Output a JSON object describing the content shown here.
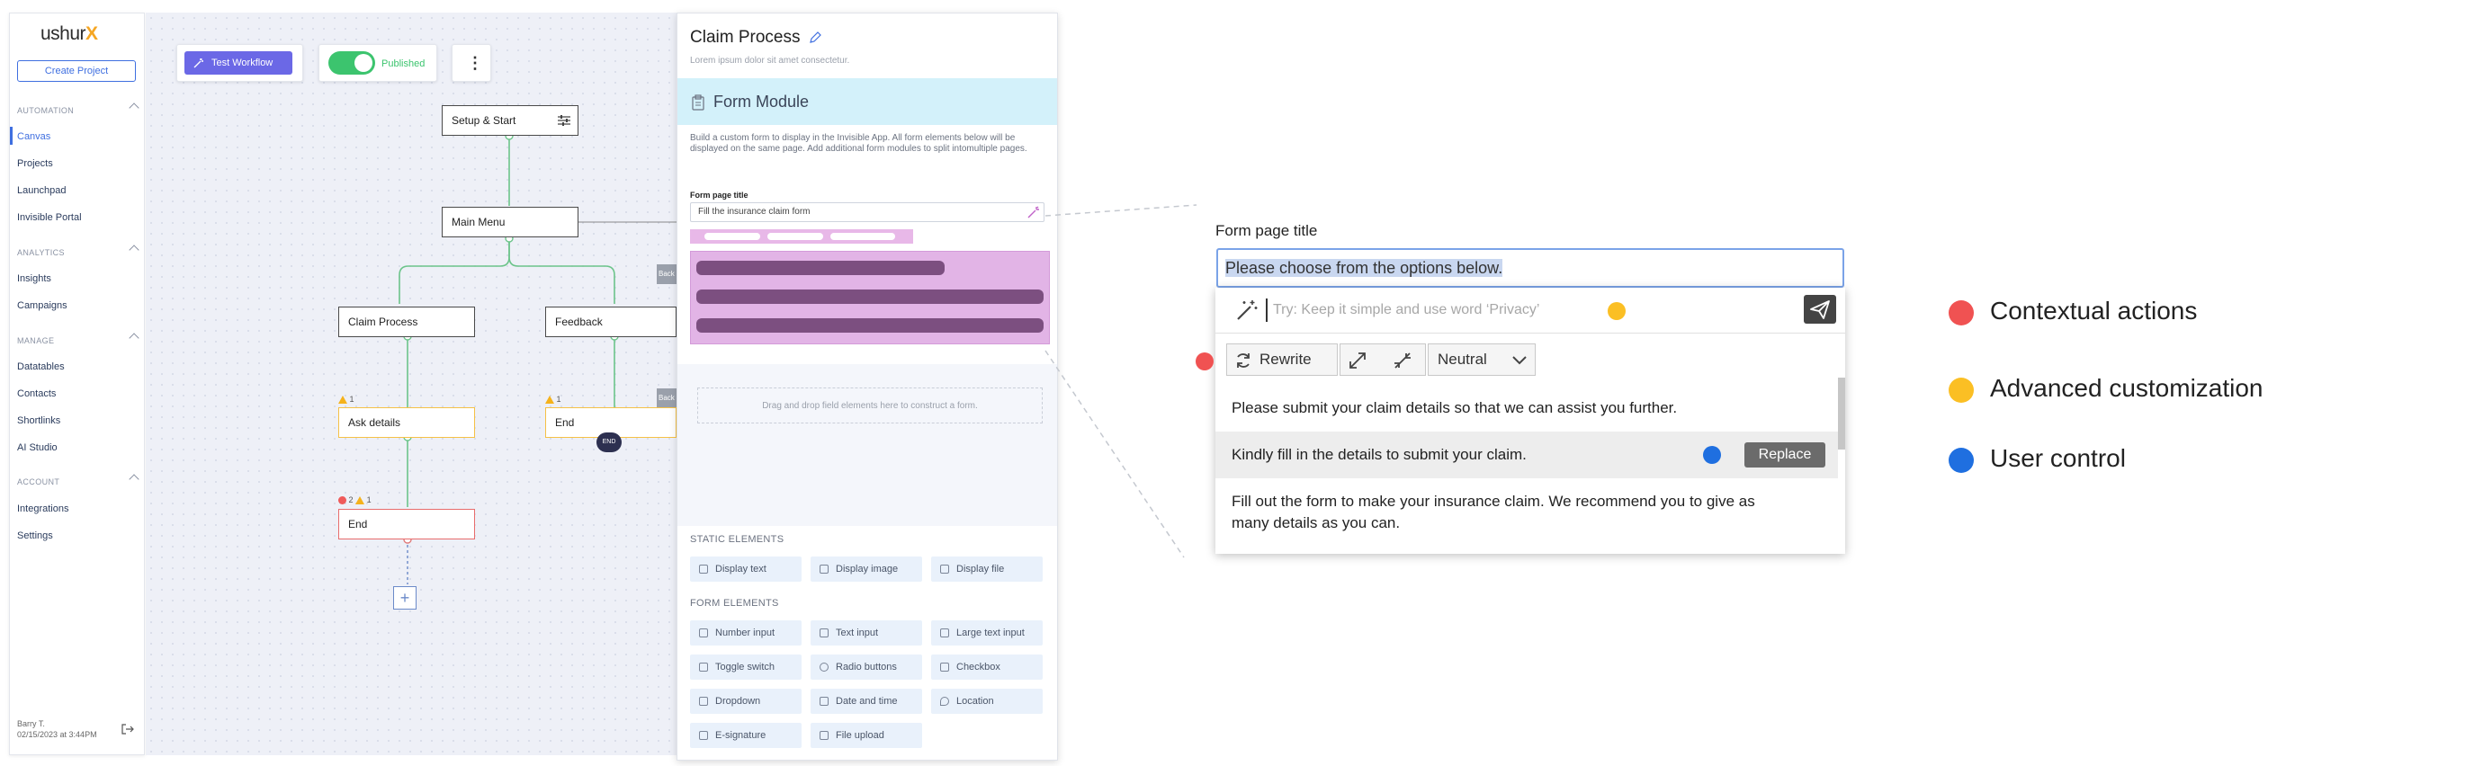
{
  "sidebar": {
    "logo_text": "ushur",
    "logo_mark": "X",
    "create_button": "Create Project",
    "sections": [
      {
        "title": "AUTOMATION",
        "items": [
          "Canvas",
          "Projects",
          "Launchpad",
          "Invisible Portal"
        ]
      },
      {
        "title": "ANALYTICS",
        "items": [
          "Insights",
          "Campaigns"
        ]
      },
      {
        "title": "MANAGE",
        "items": [
          "Datatables",
          "Contacts",
          "Shortlinks",
          "AI Studio"
        ]
      },
      {
        "title": "ACCOUNT",
        "items": [
          "Integrations",
          "Settings"
        ]
      }
    ],
    "active_item": "Canvas",
    "user_name": "Barry T.",
    "user_timestamp": "02/15/2023 at 3:44PM"
  },
  "toolbar": {
    "test_button": "Test Workflow",
    "published_label": "Published",
    "published_on": true
  },
  "workflow": {
    "nodes": {
      "setup": "Setup & Start",
      "main_menu": "Main Menu",
      "claim": "Claim Process",
      "feedback": "Feedback",
      "ask_details": "Ask details",
      "end_left": "End",
      "end_right": "End",
      "end_bottom": "End"
    },
    "end_pill": "END",
    "back_label": "Back",
    "warn_count": "1",
    "error_count": "2",
    "add_label": "+"
  },
  "panel": {
    "title": "Claim Process",
    "subtitle": "Lorem ipsum dolor sit amet consectetur.",
    "module_title": "Form Module",
    "description": "Build a custom form to display in the Invisible App. All form elements below will be displayed on the same page. Add additional form modules to split intomultiple pages.",
    "form_page_title_label": "Form page title",
    "form_page_title_value": "Fill the insurance claim form",
    "dropzone": "Drag and drop field elements here to construct a form.",
    "static_heading": "STATIC ELEMENTS",
    "static_elements": [
      "Display text",
      "Display image",
      "Display file"
    ],
    "form_heading": "FORM ELEMENTS",
    "form_elements": [
      "Number input",
      "Text input",
      "Large text input",
      "Toggle switch",
      "Radio buttons",
      "Checkbox",
      "Dropdown",
      "Date and time",
      "Location",
      "E-signature",
      "File upload"
    ]
  },
  "ai_assist": {
    "label": "Form page title",
    "input_value": "Please choose from the options below.",
    "prompt_placeholder": "Try: Keep it simple and use word ‘Privacy’",
    "rewrite": "Rewrite",
    "tone": "Neutral",
    "options": [
      "Please submit your claim details so that we can assist you further.",
      "Kindly fill in the details to submit your claim.",
      "Fill out the form to make your insurance claim. We recommend you to give as many details as you can."
    ],
    "replace_button": "Replace"
  },
  "legend": [
    {
      "label": "Contextual actions",
      "color": "#f05252"
    },
    {
      "label": "Advanced customization",
      "color": "#fbbf24"
    },
    {
      "label": "User control",
      "color": "#1f6fe0"
    }
  ]
}
